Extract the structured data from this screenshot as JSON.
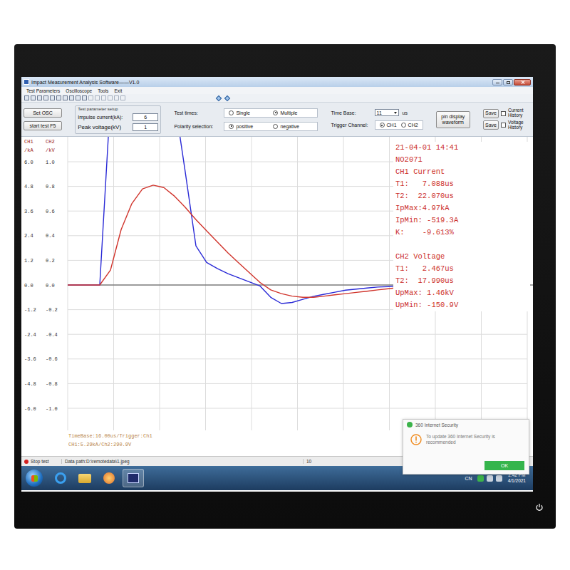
{
  "window": {
    "title": "Impact Measurement Analysis Software——V1.0"
  },
  "menu": [
    "Test Parameters",
    "Oscilloscope",
    "Tools",
    "Exit"
  ],
  "side_buttons": [
    "Set OSC",
    "start test F5"
  ],
  "setup": {
    "legend": "Test parameter setup",
    "fields": [
      {
        "label": "Impulse current(kA):",
        "value": "6"
      },
      {
        "label": "Peak voltage(kV)",
        "value": "1"
      }
    ]
  },
  "radio_groups": [
    {
      "label": "Test times:",
      "options": [
        {
          "label": "Single",
          "selected": false
        },
        {
          "label": "Multiple",
          "selected": true
        }
      ]
    },
    {
      "label": "Polarity selection:",
      "options": [
        {
          "label": "positive",
          "selected": true
        },
        {
          "label": "negative",
          "selected": false
        }
      ]
    }
  ],
  "time_base": {
    "label": "Time Base:",
    "value": "11",
    "unit": "us"
  },
  "trigger": {
    "label": "Trigger Channel:",
    "options": [
      {
        "label": "CH1",
        "selected": true
      },
      {
        "label": "CH2",
        "selected": false
      }
    ]
  },
  "pin_button": "pin display waveform",
  "history": [
    {
      "button": "Save",
      "label": "Current History",
      "checked": false
    },
    {
      "button": "Save",
      "label": "Voltage History",
      "checked": false
    }
  ],
  "chart": {
    "axes": [
      {
        "label": "CH1",
        "unit": "/kA",
        "ticks": [
          "6.0",
          "4.8",
          "3.6",
          "2.4",
          "1.2",
          "0.0",
          "-1.2",
          "-2.4",
          "-3.6",
          "-4.8",
          "-6.0"
        ]
      },
      {
        "label": "CH2",
        "unit": "/kV",
        "ticks": [
          "1.0",
          "0.8",
          "0.6",
          "0.4",
          "0.2",
          "0.0",
          "-0.2",
          "-0.4",
          "-0.6",
          "-0.8",
          "-1.0"
        ]
      }
    ],
    "series": [
      {
        "name": "CH1 Current",
        "color": "#2a2ad6",
        "values": [
          0,
          0,
          0,
          0,
          9,
          9,
          9,
          9,
          9,
          9,
          9,
          5.5,
          1.9,
          1.1,
          0.8,
          0.55,
          0.35,
          0.15,
          -0.05,
          -0.6,
          -0.9,
          -0.85,
          -0.7,
          -0.55,
          -0.45,
          -0.35,
          -0.25,
          -0.2,
          -0.15,
          -0.1,
          -0.08,
          -0.05,
          -0.05,
          0,
          0,
          0,
          0,
          0,
          0,
          0,
          0,
          0,
          0,
          0
        ]
      },
      {
        "name": "CH2 Voltage",
        "color": "#d0342c",
        "values": [
          0,
          0,
          0,
          0,
          0.12,
          0.45,
          0.66,
          0.78,
          0.81,
          0.79,
          0.72,
          0.63,
          0.53,
          0.44,
          0.35,
          0.26,
          0.18,
          0.1,
          0.02,
          -0.04,
          -0.07,
          -0.09,
          -0.1,
          -0.1,
          -0.09,
          -0.08,
          -0.07,
          -0.06,
          -0.05,
          -0.04,
          -0.03,
          -0.02,
          -0.01,
          0,
          0,
          0,
          0,
          0,
          0,
          0,
          0,
          0,
          0,
          0
        ]
      }
    ],
    "footer": [
      "TimeBase:16.00us/Trigger:Ch1",
      "CH1:5.29kA/Ch2:290.9V"
    ]
  },
  "readout": {
    "timestamp": "21-04-01 14:41",
    "number": "NO2071",
    "groups": [
      {
        "title": "CH1 Current",
        "lines": [
          "T1:   7.088us",
          "T2:  22.070us",
          "IpMax:4.97kA",
          "IpMin: -519.3A",
          "K:    -9.613%"
        ]
      },
      {
        "title": "CH2 Voltage",
        "lines": [
          "T1:   2.467us",
          "T2:  17.990us",
          "UpMax: 1.46kV",
          "UpMin: -150.9V"
        ]
      }
    ]
  },
  "status_bar": {
    "state": "Stop test",
    "path": "Data path:D:\\remotedata\\1.jpeg",
    "page": "10"
  },
  "taskbar": {
    "tray": "CN",
    "time": "2:42 PM",
    "date": "4/1/2021"
  },
  "notification": {
    "title": "360 Internet Security",
    "message": "To update 360 Internet Security is recommended",
    "button": "OK"
  }
}
